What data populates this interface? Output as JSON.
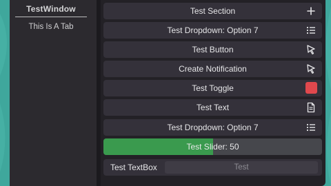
{
  "window": {
    "title": "TestWindow"
  },
  "tabs": [
    {
      "label": "This Is A Tab"
    }
  ],
  "rows": {
    "section": {
      "label": "Test Section",
      "icon": "plus-icon"
    },
    "dropdown1": {
      "label": "Test Dropdown: Option 7",
      "icon": "list-icon"
    },
    "button": {
      "label": "Test Button",
      "icon": "cursor-icon"
    },
    "notification": {
      "label": "Create Notification",
      "icon": "cursor-icon"
    },
    "toggle": {
      "label": "Test Toggle",
      "state": false,
      "color": "#e0484d"
    },
    "text": {
      "label": "Test Text",
      "icon": "document-icon"
    },
    "dropdown2": {
      "label": "Test Dropdown: Option 7",
      "icon": "list-icon"
    },
    "slider": {
      "label": "Test Slider: 50",
      "value": 50,
      "min": 0,
      "max": 100,
      "fill_fraction": 0.5,
      "color": "#3a9a4e"
    },
    "textbox": {
      "label": "Test TextBox",
      "placeholder": "Test"
    }
  },
  "colors": {
    "background": "#3fa79c",
    "window": "#232126",
    "row": "#34313a",
    "accent_green": "#3a9a4e",
    "accent_red": "#e0484d"
  }
}
